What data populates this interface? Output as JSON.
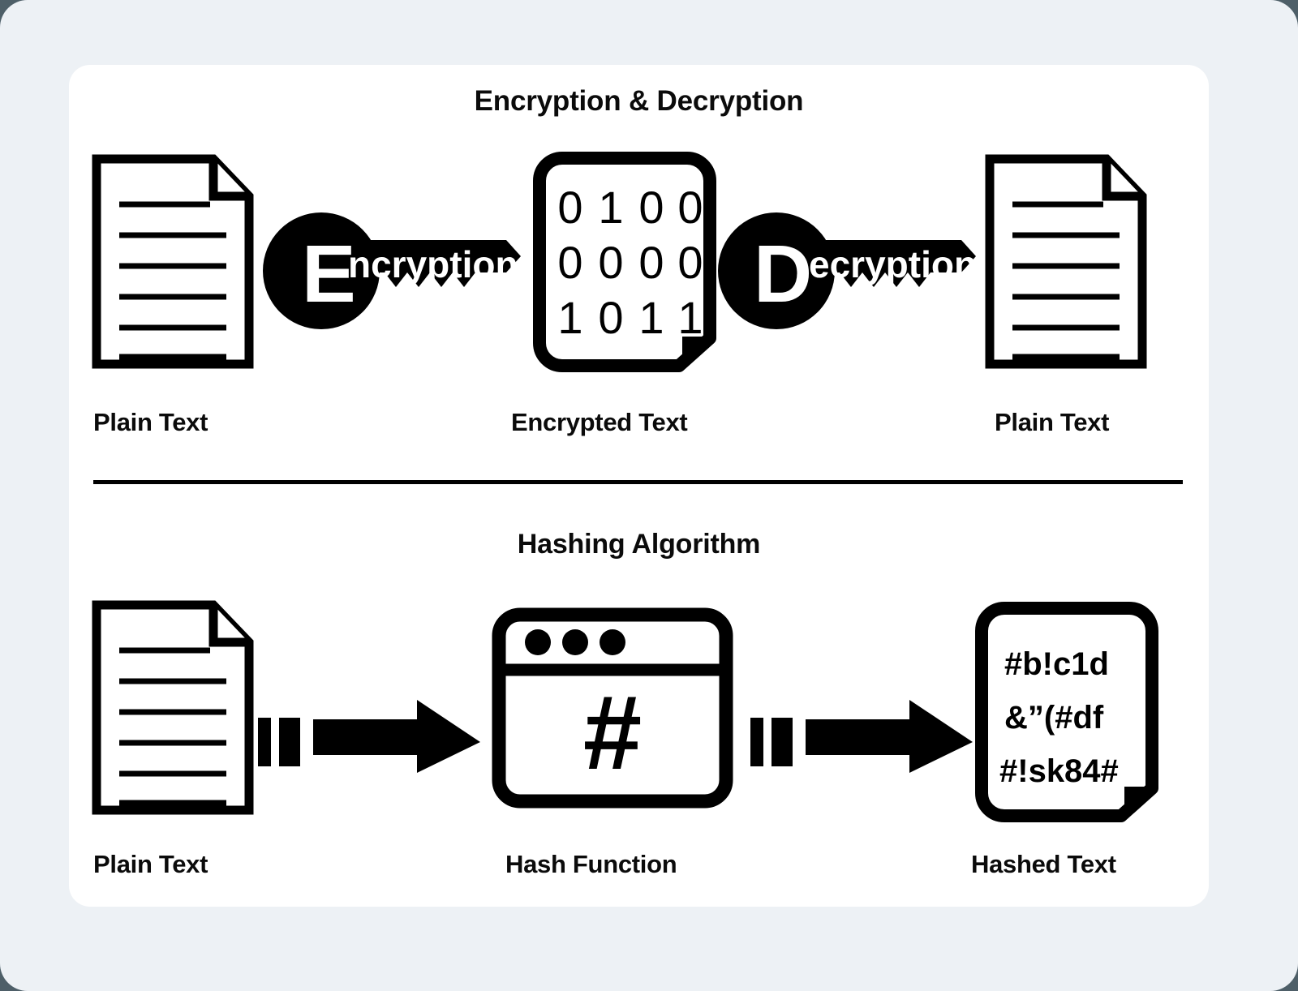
{
  "diagram": {
    "sections": [
      {
        "id": "encryption-decryption",
        "title": "Encryption & Decryption",
        "nodes": [
          {
            "id": "plain-text-left",
            "label": "Plain Text",
            "icon": "document-icon"
          },
          {
            "id": "encryption-key",
            "label": "Encryption",
            "icon": "key-icon",
            "initial": "E",
            "rest": "ncryption"
          },
          {
            "id": "encrypted-text",
            "label": "Encrypted Text",
            "icon": "binary-document-icon"
          },
          {
            "id": "decryption-key",
            "label": "Decryption",
            "icon": "key-icon",
            "initial": "D",
            "rest": "ecryption"
          },
          {
            "id": "plain-text-right",
            "label": "Plain Text",
            "icon": "document-icon"
          }
        ],
        "binary_rows": [
          [
            "0",
            "1",
            "0",
            "0"
          ],
          [
            "0",
            "0",
            "0",
            "0"
          ],
          [
            "1",
            "0",
            "1",
            "1"
          ]
        ]
      },
      {
        "id": "hashing-algorithm",
        "title": "Hashing Algorithm",
        "nodes": [
          {
            "id": "plain-text-hash-input",
            "label": "Plain Text",
            "icon": "document-icon"
          },
          {
            "id": "hash-function",
            "label": "Hash Function",
            "icon": "hash-window-icon",
            "glyph": "#"
          },
          {
            "id": "hashed-text",
            "label": "Hashed Text",
            "icon": "hashed-document-icon"
          }
        ],
        "hash_lines": [
          "#b!c1d",
          "&”(#df",
          "#!sk84#"
        ]
      }
    ],
    "colors": {
      "stroke": "#000000",
      "card_background": "#ffffff",
      "page_background": "#edf1f5",
      "outer_background": "#4e5f68",
      "key_text": "#ffffff"
    }
  }
}
